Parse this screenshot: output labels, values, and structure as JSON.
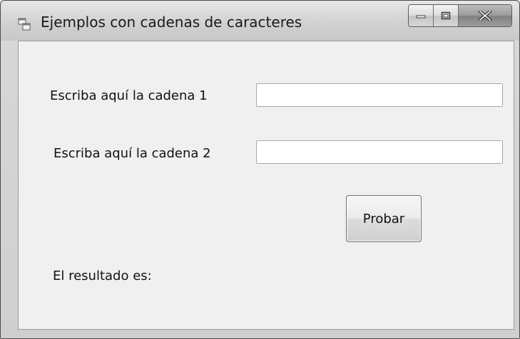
{
  "window": {
    "title": "Ejemplos con cadenas de caracteres",
    "icon": "application-window-icon",
    "controls": {
      "minimize": "minimize-icon",
      "maximize": "maximize-icon",
      "close_label": "X"
    }
  },
  "form": {
    "label1": "Escriba aquí la cadena 1",
    "input1_value": "",
    "label2": "Escriba aquí la cadena 2",
    "input2_value": "",
    "button_label": "Probar",
    "result_label": "El resultado es:"
  },
  "colors": {
    "client_background": "#f0f0f0",
    "titlebar": "#d0d0d0",
    "text": "#111111"
  }
}
